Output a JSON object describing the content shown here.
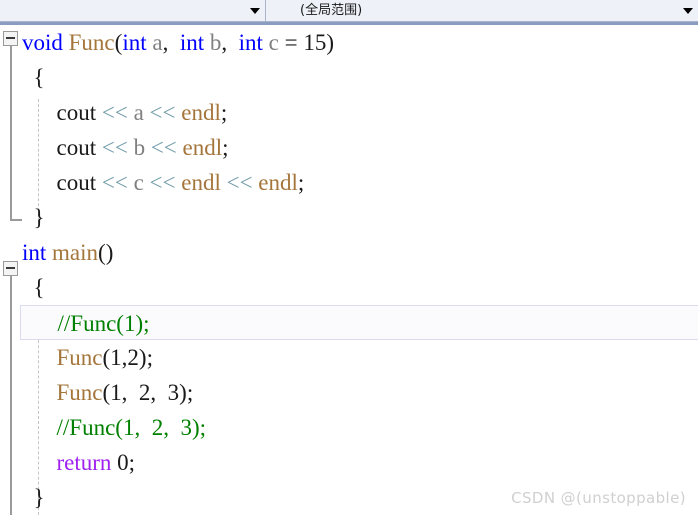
{
  "nav": {
    "left_combo": {
      "value": "",
      "placeholder": "",
      "arrow": "chevron-down-icon"
    },
    "right_combo": {
      "value": "(全局范围)",
      "placeholder": "",
      "arrow": "chevron-down-icon"
    }
  },
  "editor": {
    "lines": [
      {
        "id": 1,
        "fold": "collapse",
        "tokens": [
          {
            "t": "void",
            "c": "kw"
          },
          {
            "t": " ",
            "c": "punct"
          },
          {
            "t": "Func",
            "c": "fn"
          },
          {
            "t": "(",
            "c": "punct"
          },
          {
            "t": "int",
            "c": "kw"
          },
          {
            "t": " ",
            "c": "punct"
          },
          {
            "t": "a",
            "c": "var"
          },
          {
            "t": ",  ",
            "c": "punct"
          },
          {
            "t": "int",
            "c": "kw"
          },
          {
            "t": " ",
            "c": "punct"
          },
          {
            "t": "b",
            "c": "var"
          },
          {
            "t": ",  ",
            "c": "punct"
          },
          {
            "t": "int",
            "c": "kw"
          },
          {
            "t": " ",
            "c": "punct"
          },
          {
            "t": "c",
            "c": "var"
          },
          {
            "t": " = ",
            "c": "punct"
          },
          {
            "t": "15",
            "c": "num"
          },
          {
            "t": ")",
            "c": "punct"
          }
        ]
      },
      {
        "id": 2,
        "fold": "none",
        "tokens": [
          {
            "t": "  {",
            "c": "brace"
          }
        ]
      },
      {
        "id": 3,
        "fold": "none",
        "tokens": [
          {
            "t": "      ",
            "c": "punct"
          },
          {
            "t": "cout",
            "c": "ident"
          },
          {
            "t": " ",
            "c": "punct"
          },
          {
            "t": "<<",
            "c": "op"
          },
          {
            "t": " ",
            "c": "punct"
          },
          {
            "t": "a",
            "c": "var"
          },
          {
            "t": " ",
            "c": "punct"
          },
          {
            "t": "<<",
            "c": "op"
          },
          {
            "t": " ",
            "c": "punct"
          },
          {
            "t": "endl",
            "c": "fn"
          },
          {
            "t": ";",
            "c": "punct"
          }
        ]
      },
      {
        "id": 4,
        "fold": "none",
        "tokens": [
          {
            "t": "      ",
            "c": "punct"
          },
          {
            "t": "cout",
            "c": "ident"
          },
          {
            "t": " ",
            "c": "punct"
          },
          {
            "t": "<<",
            "c": "op"
          },
          {
            "t": " ",
            "c": "punct"
          },
          {
            "t": "b",
            "c": "var"
          },
          {
            "t": " ",
            "c": "punct"
          },
          {
            "t": "<<",
            "c": "op"
          },
          {
            "t": " ",
            "c": "punct"
          },
          {
            "t": "endl",
            "c": "fn"
          },
          {
            "t": ";",
            "c": "punct"
          }
        ]
      },
      {
        "id": 5,
        "fold": "none",
        "tokens": [
          {
            "t": "      ",
            "c": "punct"
          },
          {
            "t": "cout",
            "c": "ident"
          },
          {
            "t": " ",
            "c": "punct"
          },
          {
            "t": "<<",
            "c": "op"
          },
          {
            "t": " ",
            "c": "punct"
          },
          {
            "t": "c",
            "c": "var"
          },
          {
            "t": " ",
            "c": "punct"
          },
          {
            "t": "<<",
            "c": "op"
          },
          {
            "t": " ",
            "c": "punct"
          },
          {
            "t": "endl",
            "c": "fn"
          },
          {
            "t": " ",
            "c": "punct"
          },
          {
            "t": "<<",
            "c": "op"
          },
          {
            "t": " ",
            "c": "punct"
          },
          {
            "t": "endl",
            "c": "fn"
          },
          {
            "t": ";",
            "c": "punct"
          }
        ]
      },
      {
        "id": 6,
        "fold": "none",
        "tokens": [
          {
            "t": "  }",
            "c": "brace"
          }
        ]
      },
      {
        "id": 7,
        "fold": "collapse",
        "tokens": [
          {
            "t": "int",
            "c": "kw"
          },
          {
            "t": " ",
            "c": "punct"
          },
          {
            "t": "main",
            "c": "fn"
          },
          {
            "t": "()",
            "c": "punct"
          }
        ]
      },
      {
        "id": 8,
        "fold": "none",
        "tokens": [
          {
            "t": "  {",
            "c": "brace"
          }
        ]
      },
      {
        "id": 9,
        "fold": "none",
        "current": true,
        "tokens": [
          {
            "t": "      ",
            "c": "punct"
          },
          {
            "t": "//Func(1);",
            "c": "cmt"
          }
        ]
      },
      {
        "id": 10,
        "fold": "none",
        "tokens": [
          {
            "t": "      ",
            "c": "punct"
          },
          {
            "t": "Func",
            "c": "fn"
          },
          {
            "t": "(",
            "c": "punct"
          },
          {
            "t": "1",
            "c": "num"
          },
          {
            "t": ",",
            "c": "punct"
          },
          {
            "t": "2",
            "c": "num"
          },
          {
            "t": ");",
            "c": "punct"
          }
        ]
      },
      {
        "id": 11,
        "fold": "none",
        "tokens": [
          {
            "t": "      ",
            "c": "punct"
          },
          {
            "t": "Func",
            "c": "fn"
          },
          {
            "t": "(",
            "c": "punct"
          },
          {
            "t": "1",
            "c": "num"
          },
          {
            "t": ",  ",
            "c": "punct"
          },
          {
            "t": "2",
            "c": "num"
          },
          {
            "t": ",  ",
            "c": "punct"
          },
          {
            "t": "3",
            "c": "num"
          },
          {
            "t": ");",
            "c": "punct"
          }
        ]
      },
      {
        "id": 12,
        "fold": "none",
        "tokens": [
          {
            "t": "      ",
            "c": "punct"
          },
          {
            "t": "//Func(1,  2,  3);",
            "c": "cmt"
          }
        ]
      },
      {
        "id": 13,
        "fold": "none",
        "tokens": [
          {
            "t": "      ",
            "c": "punct"
          },
          {
            "t": "return",
            "c": "ctrl"
          },
          {
            "t": " ",
            "c": "punct"
          },
          {
            "t": "0",
            "c": "num"
          },
          {
            "t": ";",
            "c": "punct"
          }
        ]
      },
      {
        "id": 14,
        "fold": "none",
        "tokens": [
          {
            "t": "  }",
            "c": "brace"
          }
        ]
      }
    ]
  },
  "watermark": {
    "text": "CSDN @(unstoppable)"
  },
  "colors": {
    "keyword": "#0000ff",
    "control": "#a020f0",
    "function": "#a5763b",
    "variable": "#808080",
    "operator": "#6f9aa8",
    "comment": "#008000",
    "plain": "#1a1a1a",
    "nav_bg": "#eef1f8",
    "nav_border": "#8a9cc0",
    "editor_bg": "#ffffff",
    "watermark": "#d0d0d0"
  }
}
